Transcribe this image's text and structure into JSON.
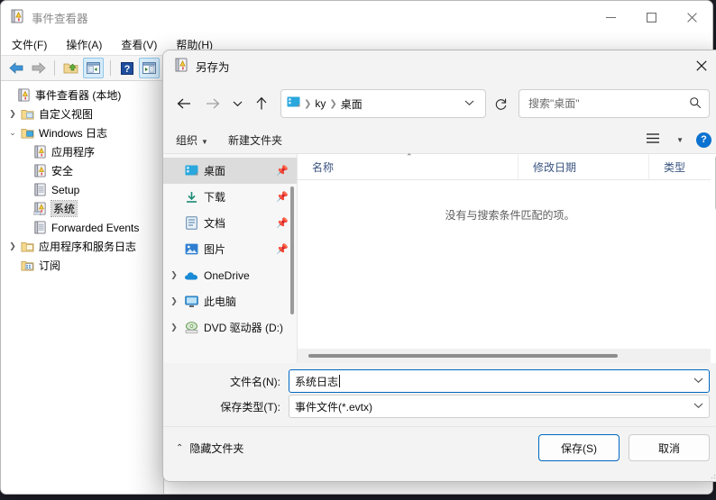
{
  "main_window": {
    "title": "事件查看器",
    "title_icon": "event-viewer-icon",
    "menu": [
      {
        "label": "文件(F)"
      },
      {
        "label": "操作(A)"
      },
      {
        "label": "查看(V)"
      },
      {
        "label": "帮助(H)"
      }
    ],
    "window_controls": {
      "minimize": "minimize-icon",
      "maximize": "maximize-icon",
      "close": "close-icon"
    },
    "toolbar": [
      {
        "name": "back-button",
        "icon": "arrow-left-icon"
      },
      {
        "name": "forward-button",
        "icon": "arrow-right-icon"
      },
      {
        "name": "up-folder-button",
        "icon": "folder-up-icon"
      },
      {
        "name": "show-console-tree-button",
        "icon": "console-tree-icon",
        "active": true
      },
      {
        "name": "help-button",
        "icon": "question-mark-icon"
      },
      {
        "name": "show-action-pane-button",
        "icon": "action-pane-icon",
        "active": true
      }
    ],
    "tree": [
      {
        "label": "事件查看器 (本地)",
        "icon": "event-viewer-icon",
        "depth": 0,
        "chevron": "",
        "selected": false
      },
      {
        "label": "自定义视图",
        "icon": "folder-view-icon",
        "depth": 1,
        "chevron": "collapsed",
        "selected": false
      },
      {
        "label": "Windows 日志",
        "icon": "windows-logs-icon",
        "depth": 1,
        "chevron": "expanded",
        "selected": false
      },
      {
        "label": "应用程序",
        "icon": "log-icon",
        "depth": 2,
        "chevron": "",
        "selected": false
      },
      {
        "label": "安全",
        "icon": "log-icon",
        "depth": 2,
        "chevron": "",
        "selected": false
      },
      {
        "label": "Setup",
        "icon": "log-plain-icon",
        "depth": 2,
        "chevron": "",
        "selected": false
      },
      {
        "label": "系统",
        "icon": "log-selected-icon",
        "depth": 2,
        "chevron": "",
        "selected": true
      },
      {
        "label": "Forwarded Events",
        "icon": "log-plain-icon",
        "depth": 2,
        "chevron": "",
        "selected": false
      },
      {
        "label": "应用程序和服务日志",
        "icon": "folder-services-icon",
        "depth": 1,
        "chevron": "collapsed",
        "selected": false
      },
      {
        "label": "订阅",
        "icon": "subscriptions-icon",
        "depth": 1,
        "chevron": "",
        "selected": false
      }
    ]
  },
  "dialog": {
    "title": "另存为",
    "title_icon": "event-viewer-icon",
    "close_icon": "close-icon",
    "nav": {
      "back_icon": "arrow-left-icon",
      "forward_icon": "arrow-right-icon",
      "recent_icon": "chevron-down-icon",
      "up_icon": "arrow-up-icon",
      "refresh_icon": "refresh-icon",
      "breadcrumb_icon": "desktop-icon",
      "breadcrumb": [
        "ky",
        "桌面"
      ],
      "breadcrumb_dropdown_icon": "chevron-down-icon"
    },
    "search": {
      "placeholder": "搜索\"桌面\"",
      "value": "",
      "icon": "search-icon"
    },
    "commandbar": {
      "organize": "组织",
      "new_folder": "新建文件夹",
      "view_icon": "view-list-icon",
      "view_caret": "chevron-down-icon",
      "help_label": "?"
    },
    "places": [
      {
        "label": "桌面",
        "icon": "desktop-icon",
        "pinned": true,
        "selected": true,
        "chevron": ""
      },
      {
        "label": "下载",
        "icon": "downloads-icon",
        "pinned": true,
        "selected": false,
        "chevron": ""
      },
      {
        "label": "文档",
        "icon": "documents-icon",
        "pinned": true,
        "selected": false,
        "chevron": ""
      },
      {
        "label": "图片",
        "icon": "pictures-icon",
        "pinned": true,
        "selected": false,
        "chevron": ""
      },
      {
        "label": "OneDrive",
        "icon": "onedrive-icon",
        "pinned": false,
        "selected": false,
        "chevron": "collapsed"
      },
      {
        "label": "此电脑",
        "icon": "this-pc-icon",
        "pinned": false,
        "selected": false,
        "chevron": "collapsed"
      },
      {
        "label": "DVD 驱动器 (D:)",
        "icon": "dvd-drive-icon",
        "pinned": false,
        "selected": false,
        "chevron": "collapsed"
      }
    ],
    "columns": [
      {
        "label": "名称",
        "sorted": "asc"
      },
      {
        "label": "修改日期",
        "sorted": ""
      },
      {
        "label": "类型",
        "sorted": ""
      }
    ],
    "empty_message": "没有与搜索条件匹配的项。",
    "file_name": {
      "label": "文件名(N):",
      "value": "系统日志",
      "dropdown_icon": "chevron-down-icon"
    },
    "save_type": {
      "label": "保存类型(T):",
      "value": "事件文件(*.evtx)",
      "dropdown_icon": "chevron-down-icon"
    },
    "footer": {
      "hide_folders": "隐藏文件夹",
      "hide_folders_icon": "chevron-up-icon",
      "save_button": "保存(S)",
      "cancel_button": "取消"
    }
  },
  "colors": {
    "accent": "#0067c0",
    "selection": "#dcdcdc",
    "header_text": "#3b5480"
  }
}
